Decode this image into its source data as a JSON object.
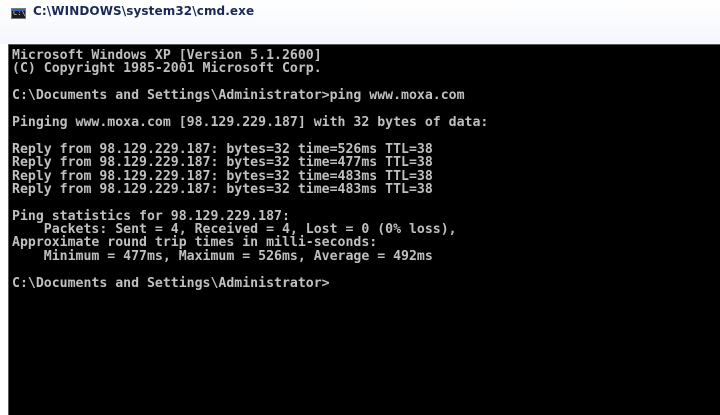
{
  "window": {
    "title": "C:\\WINDOWS\\system32\\cmd.exe",
    "icon": "cmd-app-icon",
    "icon_glyph": "C:\\"
  },
  "console": {
    "background_color": "#000000",
    "text_color": "#c0c0c0",
    "lines": [
      "Microsoft Windows XP [Version 5.1.2600]",
      "(C) Copyright 1985-2001 Microsoft Corp.",
      "",
      "C:\\Documents and Settings\\Administrator>ping www.moxa.com",
      "",
      "Pinging www.moxa.com [98.129.229.187] with 32 bytes of data:",
      "",
      "Reply from 98.129.229.187: bytes=32 time=526ms TTL=38",
      "Reply from 98.129.229.187: bytes=32 time=477ms TTL=38",
      "Reply from 98.129.229.187: bytes=32 time=483ms TTL=38",
      "Reply from 98.129.229.187: bytes=32 time=483ms TTL=38",
      "",
      "Ping statistics for 98.129.229.187:",
      "    Packets: Sent = 4, Received = 4, Lost = 0 (0% loss),",
      "Approximate round trip times in milli-seconds:",
      "    Minimum = 477ms, Maximum = 526ms, Average = 492ms",
      "",
      "C:\\Documents and Settings\\Administrator>"
    ]
  }
}
